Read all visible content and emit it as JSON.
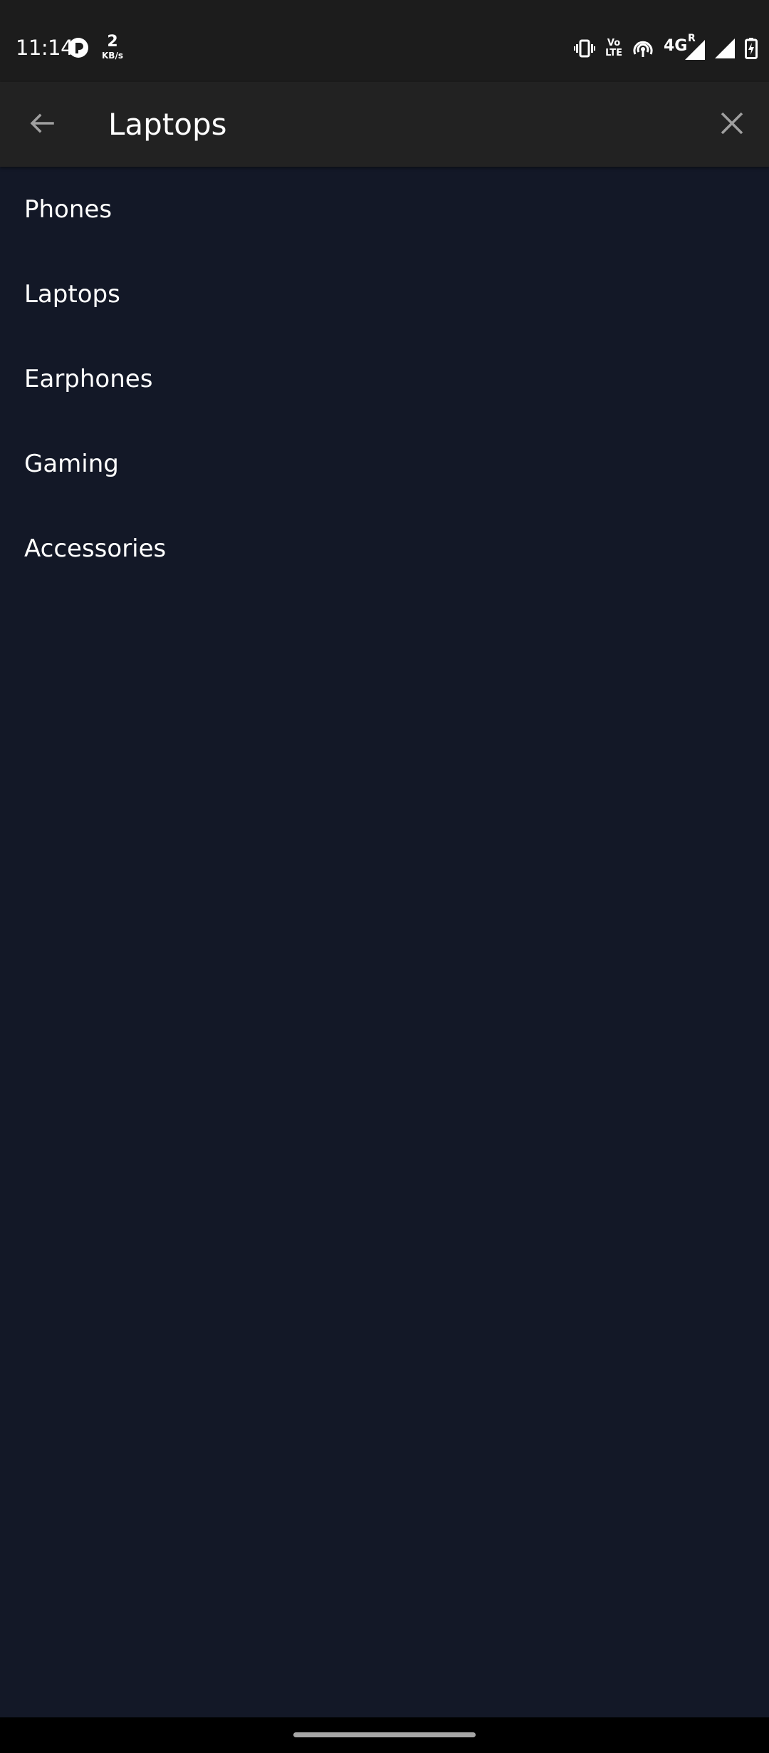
{
  "status_bar": {
    "time": "11:14",
    "netspeed_value": "2",
    "netspeed_unit": "KB/s",
    "volte_line1": "Vo",
    "volte_line2": "LTE",
    "network_type": "4G",
    "roaming": "R",
    "icons": [
      "app-notification-icon",
      "vibrate-icon",
      "volte-icon",
      "hotspot-icon",
      "signal-4g-roaming-icon",
      "signal-icon",
      "battery-charging-icon"
    ]
  },
  "search": {
    "query": "Laptops",
    "back_icon": "arrow-back-icon",
    "clear_icon": "close-icon"
  },
  "suggestions": [
    {
      "label": "Phones"
    },
    {
      "label": "Laptops"
    },
    {
      "label": "Earphones"
    },
    {
      "label": "Gaming"
    },
    {
      "label": "Accessories"
    }
  ],
  "colors": {
    "background": "#131827",
    "toolbar": "#222222",
    "status_bar": "#1c1c1c",
    "text": "#ffffff",
    "icon_muted": "#a0a0a0"
  }
}
